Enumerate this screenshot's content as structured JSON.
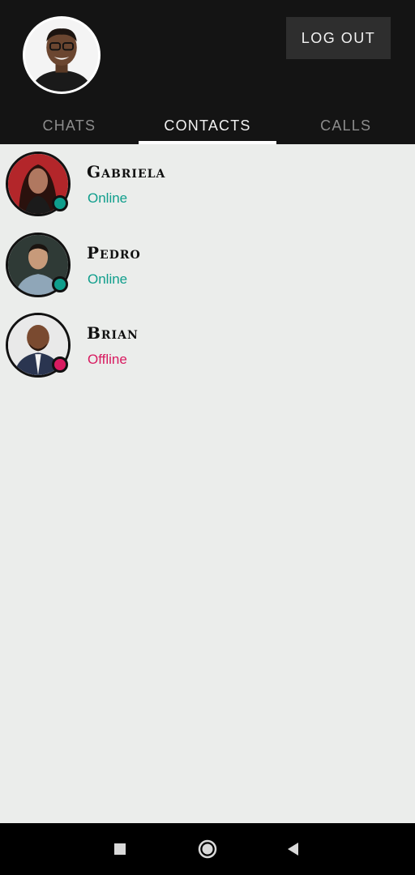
{
  "header": {
    "logout_label": "LOG OUT",
    "profile_icon": "user-avatar"
  },
  "tabs": [
    {
      "label": "CHATS",
      "active": false
    },
    {
      "label": "CONTACTS",
      "active": true
    },
    {
      "label": "CALLS",
      "active": false
    }
  ],
  "contacts": [
    {
      "name": "Gabriela",
      "status": "Online",
      "status_color": "#0f9e8c"
    },
    {
      "name": "Pedro",
      "status": "Online",
      "status_color": "#0f9e8c"
    },
    {
      "name": "Brian",
      "status": "Offline",
      "status_color": "#d81b60"
    }
  ],
  "navbar": {
    "recents_icon": "square-icon",
    "home_icon": "circle-icon",
    "back_icon": "triangle-back-icon"
  },
  "colors": {
    "online": "#0f9e8c",
    "offline": "#d81b60",
    "header_bg": "#141414",
    "content_bg": "#ebedeb"
  }
}
